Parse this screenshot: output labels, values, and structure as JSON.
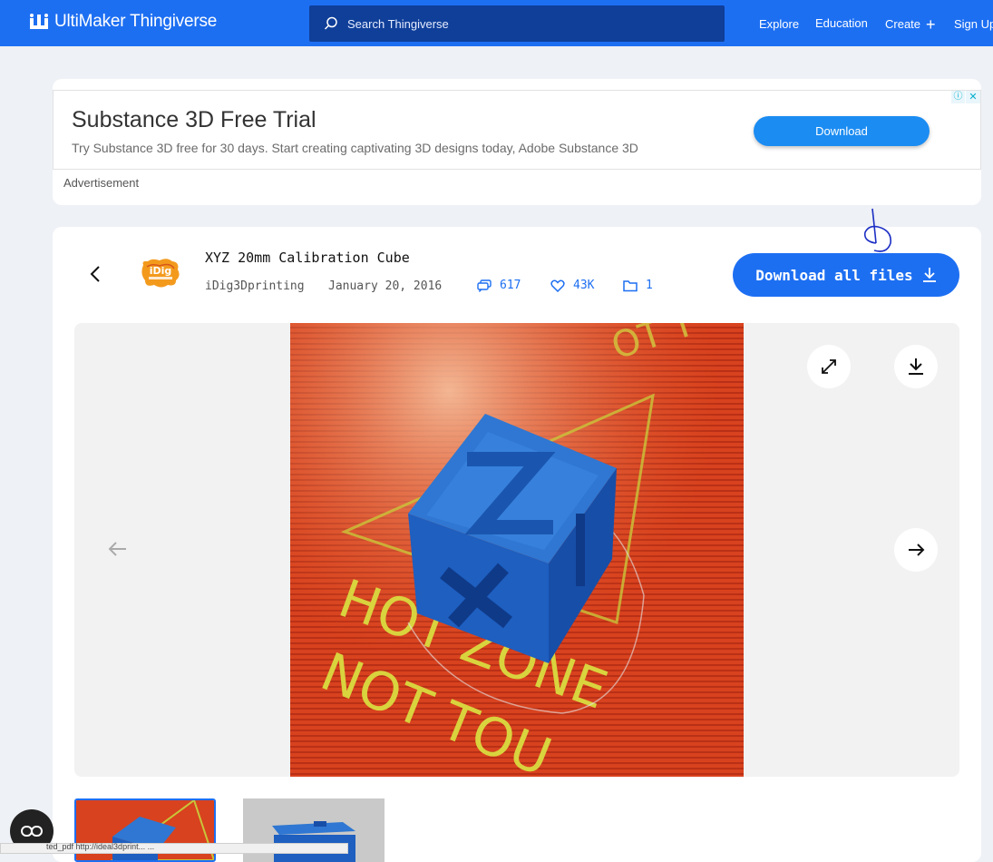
{
  "nav": {
    "brand": "UltiMaker Thingiverse",
    "search_placeholder": "Search Thingiverse",
    "links": {
      "explore": "Explore",
      "education": "Education",
      "create": "Create",
      "signup": "Sign Up"
    },
    "colors": {
      "bar": "#1d6ff2",
      "search": "#0f3f99"
    }
  },
  "ad": {
    "title": "Substance 3D Free Trial",
    "text": "Try Substance 3D free for 30 days. Start creating captivating 3D designs today, Adobe Substance 3D",
    "button": "Download",
    "label": "Advertisement",
    "info_icon": "ⓘ",
    "close_icon": "✕"
  },
  "thing": {
    "title": "XYZ 20mm Calibration Cube",
    "author": "iDig3Dprinting",
    "date": "January 20, 2016",
    "stats": {
      "comments": "617",
      "likes": "43K",
      "collections": "1"
    },
    "download_all": "Download all files",
    "avatar_text": "iDig"
  },
  "photo_text": {
    "line1": "HOT ZONE",
    "line2": "NOT TOU",
    "top": "OT T"
  },
  "status_bar_text": "ted_pdf http://ideal3dprint... ...",
  "icons": {
    "logo": "ultimaker-logo-icon",
    "search": "search-icon",
    "back": "chevron-left-icon",
    "comments": "comments-icon",
    "likes": "heart-icon",
    "collections": "folder-icon",
    "download": "download-icon",
    "expand": "expand-icon",
    "prev": "arrow-left-icon",
    "next": "arrow-right-icon",
    "float": "infinity-icon"
  }
}
